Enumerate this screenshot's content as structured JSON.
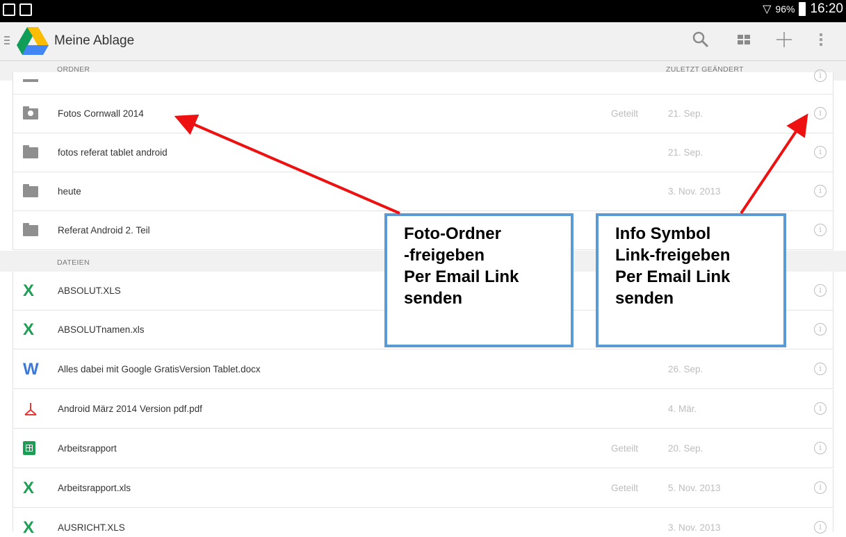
{
  "status": {
    "battery": "96%",
    "time": "16:20"
  },
  "appbar": {
    "title": "Meine Ablage"
  },
  "sections": {
    "folders": "ORDNER",
    "modified": "ZULETZT GEÄNDERT",
    "files": "DATEIEN"
  },
  "folders": [
    {
      "name": "Fotos Cornwall 2014",
      "shared": "Geteilt",
      "date": "21. Sep.",
      "icon": "shared-folder-icon"
    },
    {
      "name": "fotos referat tablet android",
      "shared": "",
      "date": "21. Sep.",
      "icon": "folder-icon"
    },
    {
      "name": "heute",
      "shared": "",
      "date": "3. Nov. 2013",
      "icon": "folder-icon"
    },
    {
      "name": "Referat Android 2. Teil",
      "shared": "",
      "date": "",
      "icon": "folder-icon"
    }
  ],
  "files": [
    {
      "name": "ABSOLUT.XLS",
      "shared": "",
      "date": "",
      "icon": "excel-icon"
    },
    {
      "name": "ABSOLUTnamen.xls",
      "shared": "",
      "date": "",
      "icon": "excel-icon"
    },
    {
      "name": "Alles dabei mit Google GratisVersion Tablet.docx",
      "shared": "",
      "date": "26. Sep.",
      "icon": "word-icon"
    },
    {
      "name": "Android März 2014 Version pdf.pdf",
      "shared": "",
      "date": "4. Mär.",
      "icon": "pdf-icon"
    },
    {
      "name": "Arbeitsrapport",
      "shared": "Geteilt",
      "date": "20. Sep.",
      "icon": "sheets-icon"
    },
    {
      "name": "Arbeitsrapport.xls",
      "shared": "Geteilt",
      "date": "5. Nov. 2013",
      "icon": "excel-icon"
    },
    {
      "name": "AUSRICHT.XLS",
      "shared": "",
      "date": "3. Nov. 2013",
      "icon": "excel-icon"
    }
  ],
  "callouts": {
    "left": [
      "Foto-Ordner",
      "-freigeben",
      "Per Email Link",
      "senden"
    ],
    "right": [
      "Info Symbol",
      "Link-freigeben",
      "Per Email Link",
      "senden"
    ]
  },
  "colors": {
    "arrow": "#ee1111",
    "callout_border": "#5b9bd5",
    "excel": "#1e9e54",
    "word": "#3c78d8",
    "pdf": "#e53935"
  }
}
